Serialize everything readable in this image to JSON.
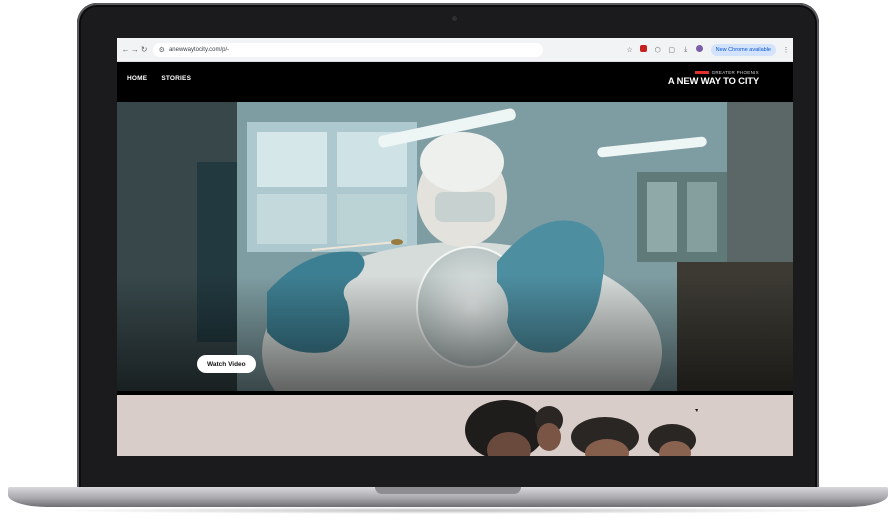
{
  "browser": {
    "url": "anewwaytocity.com/p/-",
    "update_button": "New Chrome available"
  },
  "site": {
    "nav": [
      "HOME",
      "STORIES"
    ],
    "brand_small": "GREATER PHOENIX",
    "brand_title": "A NEW WAY TO CITY"
  },
  "hero": {
    "button": "Watch Video"
  },
  "icons": [
    "back-icon",
    "forward-icon",
    "reload-icon",
    "site-settings-icon",
    "bookmark-star-icon",
    "extension-icon",
    "extensions-puzzle-icon",
    "reading-list-icon",
    "download-icon",
    "profile-avatar-icon",
    "menu-dots-icon"
  ]
}
